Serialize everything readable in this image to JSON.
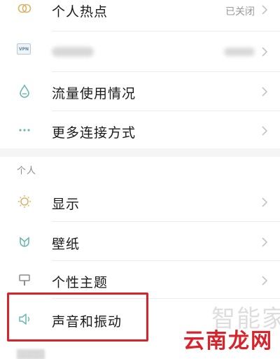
{
  "settings_list": {
    "hotspot": {
      "label": "个人热点",
      "status": "已关闭",
      "icon": "hotspot-icon"
    },
    "vpn": {
      "badge": "VPN",
      "icon": "vpn-icon"
    },
    "data_usage": {
      "label": "流量使用情况",
      "icon": "water-drop-icon"
    },
    "more_connections": {
      "label": "更多连接方式",
      "icon": "more-dots-icon"
    },
    "personal_section": {
      "title": "个人"
    },
    "display": {
      "label": "显示",
      "icon": "sun-icon"
    },
    "wallpaper": {
      "label": "壁纸",
      "icon": "flower-icon"
    },
    "theme": {
      "label": "个性主题",
      "icon": "brush-icon"
    },
    "sound": {
      "label": "声音和振动",
      "icon": "speaker-icon"
    }
  },
  "overlay": {
    "watermark": "智能家",
    "logo": "云南龙网"
  },
  "colors": {
    "icon": "#6cb6b3",
    "highlight": "#d9232a",
    "chevron": "#c4c4c4"
  }
}
